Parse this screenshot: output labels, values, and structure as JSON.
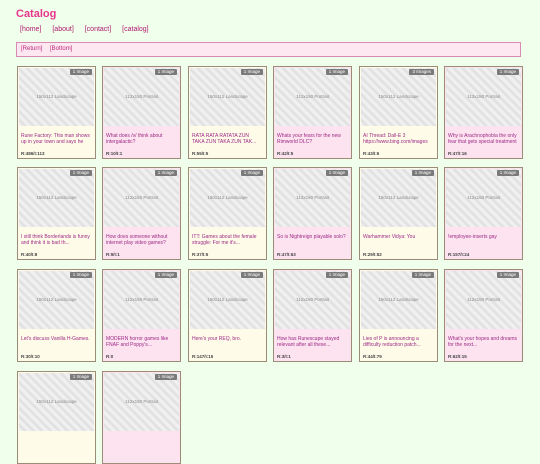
{
  "title": "Catalog",
  "nav": [
    "[home]",
    "[about]",
    "[contact]",
    "[catalog]"
  ],
  "controls": [
    "[Return]",
    "[Bottom]"
  ],
  "colors": {
    "background": "#efffec",
    "accent": "#e8348a",
    "card_bg": "#fffbe9",
    "card_bg_pink": "#fde3f0"
  },
  "threads": [
    {
      "badge": "1 Image",
      "thumb": "150x112 Landscape",
      "subject": "Rune Factory: This man shows up in your town and says he wants to work with you",
      "stats": "R:486/I:113"
    },
    {
      "badge": "1 Image",
      "thumb": "112x150 Portrait",
      "subject": "What does /v/ think about intergalactic?",
      "stats": "R:10/I:1"
    },
    {
      "badge": "1 Image",
      "thumb": "150x112 Landscape",
      "subject": "RATA RATA RATATA ZUN TAKA ZUN TAKA ZUN TAK...",
      "stats": "R:55/I:5"
    },
    {
      "badge": "1 Image",
      "thumb": "112x150 Portrait",
      "subject": "Whats your fears for the new Rimworld DLC?",
      "stats": "R:42/I:5"
    },
    {
      "badge": "3 Images",
      "thumb": "150x112 Landscape",
      "subject": "AI Thread: Dall-E 3 https://www.bing.com/images",
      "stats": "R:43/I:6"
    },
    {
      "badge": "1 Image",
      "thumb": "112x150 Portrait",
      "subject": "Why is Arachnophobia the only fear that gets special treatment in videogames?",
      "stats": "R:47/I:16"
    },
    {
      "badge": "1 Image",
      "thumb": "150x112 Landscape",
      "subject": "I still think Borderlands is funny and think it is bad th...",
      "stats": "R:40/I:8"
    },
    {
      "badge": "1 Image",
      "thumb": "112x150 Portrait",
      "subject": "How does someone without internet play video games?",
      "stats": "R:9/I:1"
    },
    {
      "badge": "1 Image",
      "thumb": "150x112 Landscape",
      "subject": "ITT: Games about the female struggle: For me it's...",
      "stats": "R:37/I:5"
    },
    {
      "badge": "1 Image",
      "thumb": "112x150 Portrait",
      "subject": "So is Nightreign playable solo?",
      "stats": "R:47/I:63"
    },
    {
      "badge": "1 Image",
      "thumb": "150x112 Landscape",
      "subject": "Warhammer Vidya: You",
      "stats": "R:29/I:52"
    },
    {
      "badge": "1 Image",
      "thumb": "112x150 Portrait",
      "subject": "!employee-inserts gay",
      "stats": "R:157/I:24"
    },
    {
      "badge": "1 Image",
      "thumb": "150x112 Landscape",
      "subject": "Let's discuss Vanilla H-Games.",
      "stats": "R:30/I:10"
    },
    {
      "badge": "1 Image",
      "thumb": "112x150 Portrait",
      "subject": "MODERN horror games like FNAF and Poppy's...",
      "stats": "R:0"
    },
    {
      "badge": "1 Image",
      "thumb": "150x112 Landscape",
      "subject": "Here's your REQ, bro.",
      "stats": "R:147/I:15"
    },
    {
      "badge": "1 Image",
      "thumb": "112x150 Portrait",
      "subject": "How has Runescape stayed relevant after all these...",
      "stats": "R:3/I:1"
    },
    {
      "badge": "1 Image",
      "thumb": "150x112 Landscape",
      "subject": "Lies of P is announcing a difficulty reduction patch...",
      "stats": "R:44/I:79"
    },
    {
      "badge": "1 Image",
      "thumb": "112x150 Portrait",
      "subject": "What's your hopes and dreams for the next...",
      "stats": "R:62/I:15"
    },
    {
      "badge": "1 Image",
      "thumb": "150x112 Landscape",
      "subject": "",
      "stats": ""
    },
    {
      "badge": "1 Image",
      "thumb": "112x150 Portrait",
      "subject": "",
      "stats": ""
    }
  ]
}
